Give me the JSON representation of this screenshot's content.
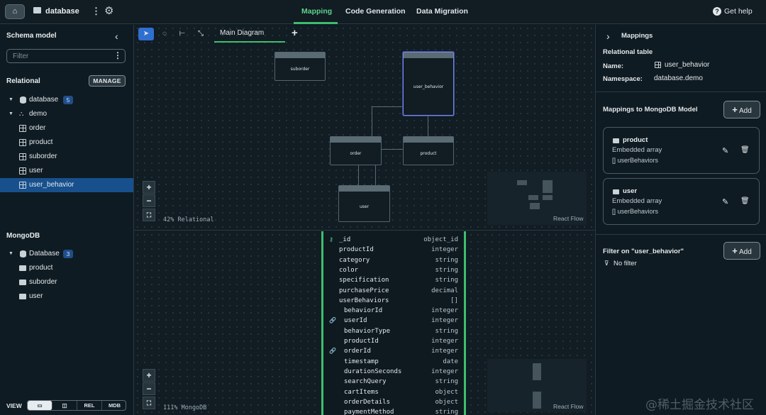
{
  "topbar": {
    "home_icon": "home-icon",
    "project_name": "database",
    "kebab": "⋮",
    "gear": "⚙",
    "tabs": [
      "Mapping",
      "Code Generation",
      "Data Migration"
    ],
    "help_label": "Get help",
    "accent_color": "#3fbd6e"
  },
  "sidebar": {
    "title": "Schema model",
    "collapse": "‹",
    "filter_placeholder": "Filter",
    "relational_heading": "Relational",
    "manage_label": "MANAGE",
    "relational_tree": {
      "database_label": "database",
      "database_count": "5",
      "schema_label": "demo",
      "tables": [
        "order",
        "product",
        "suborder",
        "user",
        "user_behavior"
      ],
      "selected": "user_behavior"
    },
    "mongodb_heading": "MongoDB",
    "mongo_tree": {
      "database_label": "Database",
      "database_count": "3",
      "collections": [
        "product",
        "suborder",
        "user"
      ]
    },
    "view_label": "VIEW",
    "view_options": [
      "REL",
      "MDB"
    ]
  },
  "diagram": {
    "tab_label": "Main Diagram",
    "add_tab": "+",
    "nodes": [
      "suborder",
      "user_behavior",
      "order",
      "product",
      "user"
    ],
    "zoom_in": "+",
    "zoom_out": "−",
    "fit": "⛶",
    "zoom_label": "42%  Relational",
    "flow_label": "React Flow"
  },
  "mongo_view": {
    "zoom_label": "111%  MongoDB",
    "flow_label": "React Flow",
    "fields": [
      {
        "name": "_id",
        "type": "object_id",
        "indent": 0,
        "icon": "key"
      },
      {
        "name": "productId",
        "type": "integer",
        "indent": 0,
        "icon": ""
      },
      {
        "name": "category",
        "type": "string",
        "indent": 0,
        "icon": ""
      },
      {
        "name": "color",
        "type": "string",
        "indent": 0,
        "icon": ""
      },
      {
        "name": "specification",
        "type": "string",
        "indent": 0,
        "icon": ""
      },
      {
        "name": "purchasePrice",
        "type": "decimal",
        "indent": 0,
        "icon": ""
      },
      {
        "name": "userBehaviors",
        "type": "[]",
        "indent": 0,
        "icon": ""
      },
      {
        "name": "behaviorId",
        "type": "integer",
        "indent": 1,
        "icon": ""
      },
      {
        "name": "userId",
        "type": "integer",
        "indent": 1,
        "icon": "link"
      },
      {
        "name": "behaviorType",
        "type": "string",
        "indent": 1,
        "icon": ""
      },
      {
        "name": "productId",
        "type": "integer",
        "indent": 1,
        "icon": ""
      },
      {
        "name": "orderId",
        "type": "integer",
        "indent": 1,
        "icon": "link"
      },
      {
        "name": "timestamp",
        "type": "date",
        "indent": 1,
        "icon": ""
      },
      {
        "name": "durationSeconds",
        "type": "integer",
        "indent": 1,
        "icon": ""
      },
      {
        "name": "searchQuery",
        "type": "string",
        "indent": 1,
        "icon": ""
      },
      {
        "name": "cartItems",
        "type": "object",
        "indent": 1,
        "icon": ""
      },
      {
        "name": "orderDetails",
        "type": "object",
        "indent": 1,
        "icon": ""
      },
      {
        "name": "paymentMethod",
        "type": "string",
        "indent": 1,
        "icon": ""
      }
    ]
  },
  "right_panel": {
    "title": "Mappings",
    "section_label": "Relational table",
    "name_label": "Name:",
    "name_value": "user_behavior",
    "namespace_label": "Namespace:",
    "namespace_value": "database.demo",
    "mappings_heading": "Mappings to MongoDB Model",
    "add_label": "Add",
    "mappings": [
      {
        "title": "product",
        "subtitle": "Embedded array",
        "array": "[] userBehaviors"
      },
      {
        "title": "user",
        "subtitle": "Embedded array",
        "array": "[] userBehaviors"
      }
    ],
    "filter_heading": "Filter on \"user_behavior\"",
    "no_filter": "No filter"
  },
  "watermark": "@稀土掘金技术社区"
}
